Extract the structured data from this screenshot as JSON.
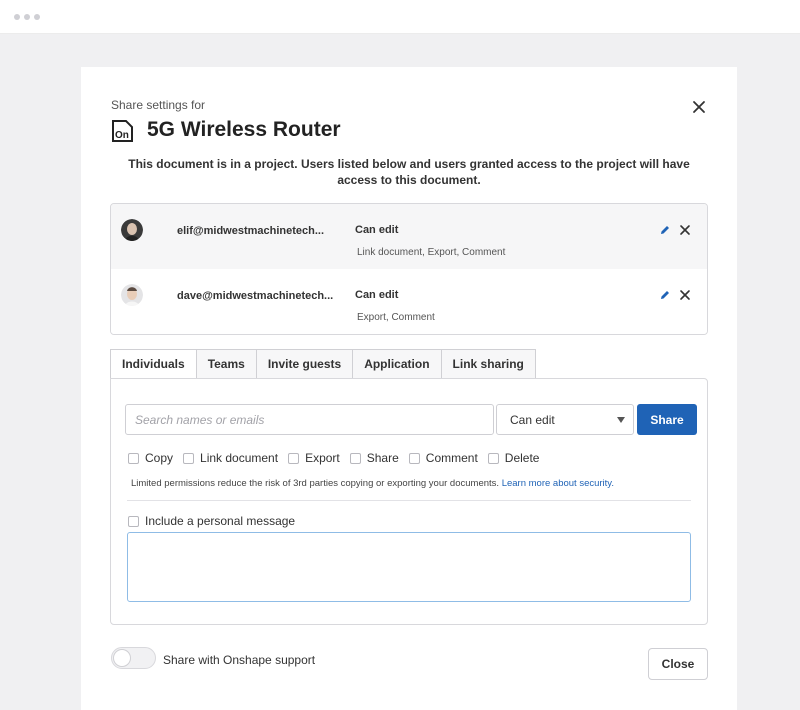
{
  "dialog": {
    "subtitle": "Share settings for",
    "title": "5G Wireless Router",
    "icon_text": "On",
    "project_note": "This document is in a project. Users listed below and users granted access to the project will have access to this document."
  },
  "users": [
    {
      "email": "elif@midwestmachinetech...",
      "permission": "Can edit",
      "details": "Link document, Export, Comment"
    },
    {
      "email": "dave@midwestmachinetech...",
      "permission": "Can edit",
      "details": "Export, Comment"
    }
  ],
  "tabs": [
    {
      "label": "Individuals",
      "active": true
    },
    {
      "label": "Teams",
      "active": false
    },
    {
      "label": "Invite guests",
      "active": false
    },
    {
      "label": "Application",
      "active": false
    },
    {
      "label": "Link sharing",
      "active": false
    }
  ],
  "share_form": {
    "search_placeholder": "Search names or emails",
    "search_value": "",
    "permission_selected": "Can edit",
    "share_label": "Share",
    "checkboxes": [
      {
        "label": "Copy",
        "checked": false
      },
      {
        "label": "Link document",
        "checked": false
      },
      {
        "label": "Export",
        "checked": false
      },
      {
        "label": "Share",
        "checked": false
      },
      {
        "label": "Comment",
        "checked": false
      },
      {
        "label": "Delete",
        "checked": false
      }
    ],
    "limited_note": "Limited permissions reduce the risk of 3rd parties copying or exporting your documents.",
    "learn_more": "Learn more about security.",
    "personal_message_label": "Include a personal message",
    "personal_message_checked": false,
    "message_value": ""
  },
  "footer": {
    "support_label": "Share with Onshape support",
    "support_enabled": false,
    "close_label": "Close"
  },
  "colors": {
    "accent": "#1f63b6",
    "message_border": "#8fbce6"
  },
  "icons": {
    "close": "close-icon",
    "document": "onshape-document-icon",
    "edit": "pencil-icon",
    "remove": "close-icon",
    "dropdown": "chevron-down-icon"
  }
}
